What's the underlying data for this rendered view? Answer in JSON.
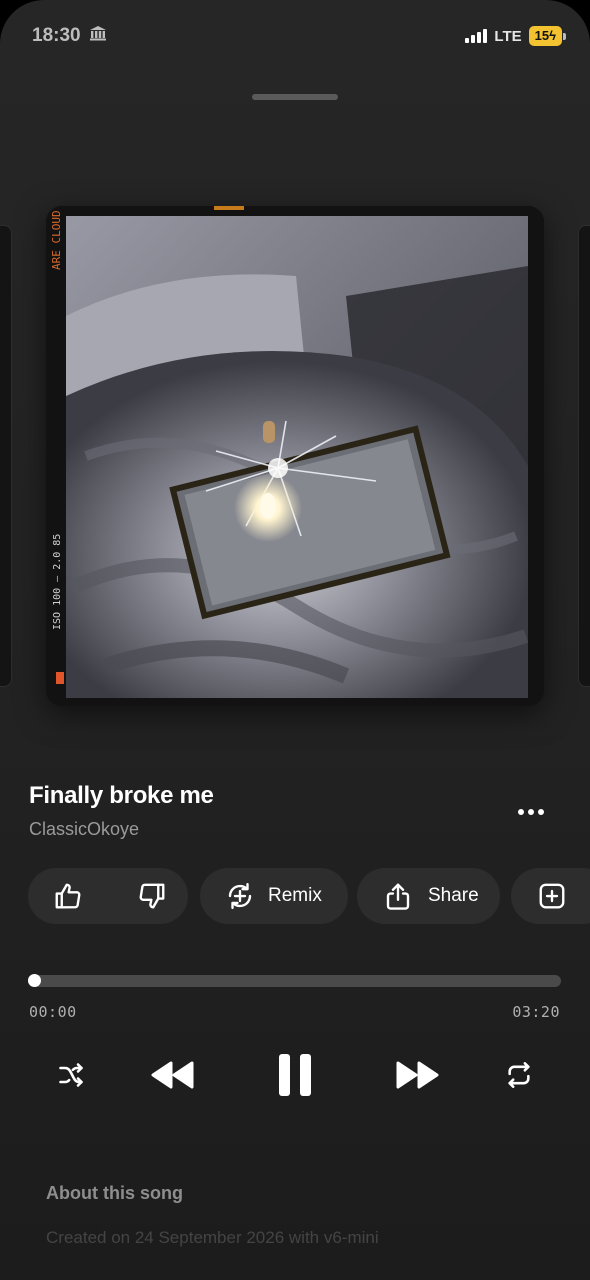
{
  "status_bar": {
    "time": "18:30",
    "network": "LTE",
    "battery": "15",
    "bank_icon": "bank-icon",
    "signal_icon": "signal-bars-icon",
    "charging_icon": "bolt-icon"
  },
  "song": {
    "title": "Finally broke me",
    "artist": "ClassicOkoye"
  },
  "actions": {
    "like_icon": "thumbs-up-icon",
    "dislike_icon": "thumbs-down-icon",
    "remix_label": "Remix",
    "remix_icon": "remix-icon",
    "share_label": "Share",
    "share_icon": "share-icon",
    "add_icon": "add-to-playlist-icon"
  },
  "player": {
    "current_time": "00:00",
    "duration": "03:20",
    "progress": 0,
    "controls": [
      "shuffle-icon",
      "rewind-icon",
      "pause-icon",
      "fast-forward-icon",
      "repeat-icon"
    ]
  },
  "about": {
    "title": "About this song",
    "description": "Created on 24 September 2026 with v6-mini"
  },
  "colors": {
    "background": "#232323",
    "pill": "#2d2d2d",
    "track": "#4a4a4a",
    "battery": "#f2c230"
  }
}
